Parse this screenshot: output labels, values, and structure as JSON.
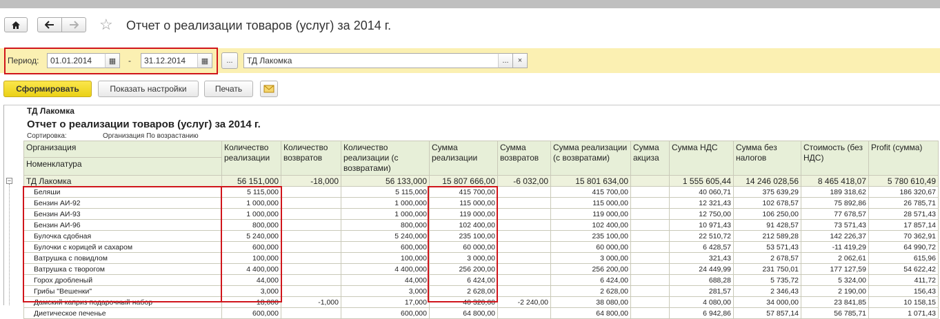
{
  "nav": {
    "home_icon": "home-icon",
    "back_icon": "arrow-left-icon",
    "forward_icon": "arrow-right-icon",
    "favorite_icon": "star-icon"
  },
  "window": {
    "title": "Отчет о реализации товаров (услуг)  за 2014 г."
  },
  "filter": {
    "period_label": "Период:",
    "date_from": "01.01.2014",
    "dash": "-",
    "date_to": "31.12.2014",
    "ellipsis": "...",
    "organization": "ТД Лакомка",
    "org_select": "...",
    "org_clear": "×"
  },
  "toolbar": {
    "generate": "Сформировать",
    "show_settings": "Показать настройки",
    "print": "Печать",
    "mail_icon": "envelope-icon"
  },
  "report": {
    "organization": "ТД Лакомка",
    "title": "Отчет о реализации товаров (услуг)  за 2014 г.",
    "sort_label": "Сортировка:",
    "sort_value": "Организация По возрастанию",
    "header_org": "Организация",
    "header_item": "Номенклатура",
    "columns": [
      "Количество реализации",
      "Количество возвратов",
      "Количество реализации (с возвратами)",
      "Сумма реализации",
      "Сумма возвратов",
      "Сумма реализации (с возвратами)",
      "Сумма акциза",
      "Сумма НДС",
      "Сумма без налогов",
      "Стоимость (без НДС)",
      "Profit (сумма)"
    ],
    "total": {
      "name": "ТД Лакомка",
      "values": [
        "56 151,000",
        "-18,000",
        "56 133,000",
        "15 807 666,00",
        "-6 032,00",
        "15 801 634,00",
        "",
        "1 555 605,44",
        "14 246 028,56",
        "8 465 418,07",
        "5 780 610,49"
      ]
    },
    "rows": [
      {
        "name": "Беляши",
        "values": [
          "5 115,000",
          "",
          "5 115,000",
          "415 700,00",
          "",
          "415 700,00",
          "",
          "40 060,71",
          "375 639,29",
          "189 318,62",
          "186 320,67"
        ]
      },
      {
        "name": "Бензин АИ-92",
        "values": [
          "1 000,000",
          "",
          "1 000,000",
          "115 000,00",
          "",
          "115 000,00",
          "",
          "12 321,43",
          "102 678,57",
          "75 892,86",
          "26 785,71"
        ]
      },
      {
        "name": "Бензин АИ-93",
        "values": [
          "1 000,000",
          "",
          "1 000,000",
          "119 000,00",
          "",
          "119 000,00",
          "",
          "12 750,00",
          "106 250,00",
          "77 678,57",
          "28 571,43"
        ]
      },
      {
        "name": "Бензин АИ-96",
        "values": [
          "800,000",
          "",
          "800,000",
          "102 400,00",
          "",
          "102 400,00",
          "",
          "10 971,43",
          "91 428,57",
          "73 571,43",
          "17 857,14"
        ]
      },
      {
        "name": "Булочка сдобная",
        "values": [
          "5 240,000",
          "",
          "5 240,000",
          "235 100,00",
          "",
          "235 100,00",
          "",
          "22 510,72",
          "212 589,28",
          "142 226,37",
          "70 362,91"
        ]
      },
      {
        "name": "Булочки с корицей и сахаром",
        "values": [
          "600,000",
          "",
          "600,000",
          "60 000,00",
          "",
          "60 000,00",
          "",
          "6 428,57",
          "53 571,43",
          "-11 419,29",
          "64 990,72"
        ]
      },
      {
        "name": "Ватрушка с повидлом",
        "values": [
          "100,000",
          "",
          "100,000",
          "3 000,00",
          "",
          "3 000,00",
          "",
          "321,43",
          "2 678,57",
          "2 062,61",
          "615,96"
        ]
      },
      {
        "name": "Ватрушка с творогом",
        "values": [
          "4 400,000",
          "",
          "4 400,000",
          "256 200,00",
          "",
          "256 200,00",
          "",
          "24 449,99",
          "231 750,01",
          "177 127,59",
          "54 622,42"
        ]
      },
      {
        "name": "Горох дробленый",
        "values": [
          "44,000",
          "",
          "44,000",
          "6 424,00",
          "",
          "6 424,00",
          "",
          "688,28",
          "5 735,72",
          "5 324,00",
          "411,72"
        ]
      },
      {
        "name": "Грибы \"Вешенки\"",
        "values": [
          "3,000",
          "",
          "3,000",
          "2 628,00",
          "",
          "2 628,00",
          "",
          "281,57",
          "2 346,43",
          "2 190,00",
          "156,43"
        ]
      },
      {
        "name": "Дамский каприз подарочный набор",
        "values": [
          "18,000",
          "-1,000",
          "17,000",
          "40 320,00",
          "-2 240,00",
          "38 080,00",
          "",
          "4 080,00",
          "34 000,00",
          "23 841,85",
          "10 158,15"
        ]
      },
      {
        "name": "Диетическое печенье",
        "values": [
          "600,000",
          "",
          "600,000",
          "64 800,00",
          "",
          "64 800,00",
          "",
          "6 942,86",
          "57 857,14",
          "56 785,71",
          "1 071,43"
        ]
      }
    ]
  }
}
